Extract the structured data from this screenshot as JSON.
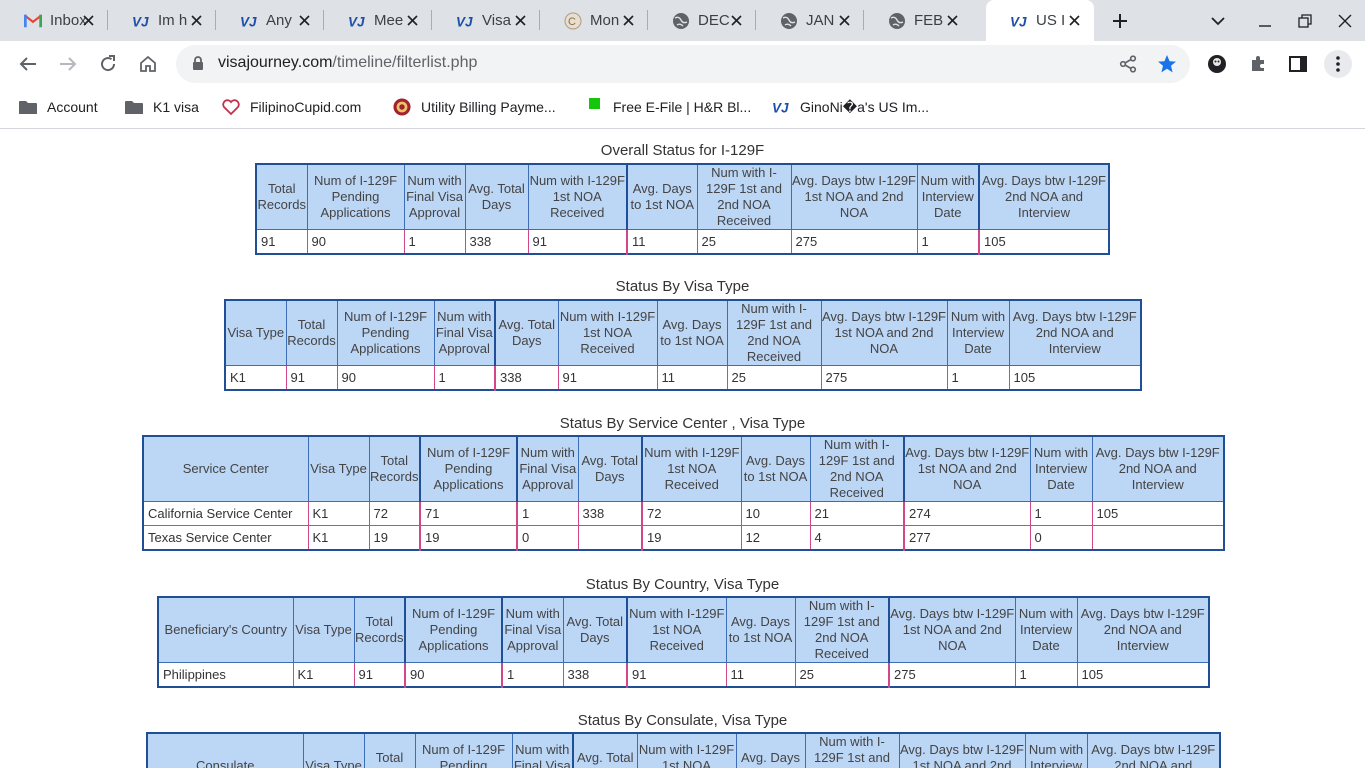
{
  "browser": {
    "tabs": [
      {
        "title": "Inbox",
        "favicon": "gmail-icon"
      },
      {
        "title": "Im h",
        "favicon": "vj-icon"
      },
      {
        "title": "Any",
        "favicon": "vj-icon"
      },
      {
        "title": "Mee",
        "favicon": "vj-icon"
      },
      {
        "title": "Visa",
        "favicon": "vj-icon"
      },
      {
        "title": "Mon",
        "favicon": "c-icon"
      },
      {
        "title": "DEC",
        "favicon": "globe-icon"
      },
      {
        "title": "JAN",
        "favicon": "globe-icon"
      },
      {
        "title": "FEB",
        "favicon": "globe-icon"
      },
      {
        "title": "US I",
        "favicon": "vj-icon",
        "active": true
      }
    ],
    "url_host": "visajourney.com",
    "url_path": "/timeline/filterlist.php",
    "bookmarks": [
      {
        "label": "Account",
        "icon": "folder-icon"
      },
      {
        "label": "K1 visa",
        "icon": "folder-icon"
      },
      {
        "label": "FilipinoCupid.com",
        "icon": "heart-icon"
      },
      {
        "label": "Utility Billing Payme...",
        "icon": "seal-icon"
      },
      {
        "label": "Free E-File | H&R Bl...",
        "icon": "green-square-icon"
      },
      {
        "label": "GinoNi�a's US Im...",
        "icon": "vj-icon"
      }
    ],
    "colors": {
      "accent_blue": "#1a73e8",
      "header_fill": "#bcd6f6",
      "cell_border": "#d0478a"
    }
  },
  "common_headers": {
    "total_records": "Total Records",
    "num_pending": "Num of I-129F Pending Applications",
    "num_final": "Num with Final Visa Approval",
    "avg_total": "Avg. Total Days",
    "num_1st_noa": "Num with I-129F 1st NOA Received",
    "avg_1st": "Avg. Days to 1st NOA",
    "num_both": "Num with I-129F 1st and 2nd NOA Received",
    "avg_btw": "Avg. Days btw I-129F 1st NOA and 2nd NOA",
    "num_interview": "Num with Interview Date",
    "avg_interview": "Avg. Days btw I-129F 2nd NOA and Interview",
    "visa_type": "Visa Type",
    "service_center": "Service Center",
    "country": "Beneficiary's Country",
    "consulate": "Consulate"
  },
  "sections": {
    "overall": {
      "title": "Overall Status for I-129F",
      "rows": [
        [
          "91",
          "90",
          "1",
          "338",
          "91",
          "11",
          "25",
          "275",
          "1",
          "105"
        ]
      ]
    },
    "visa_type": {
      "title": "Status By Visa Type",
      "rows": [
        [
          "K1",
          "91",
          "90",
          "1",
          "338",
          "91",
          "11",
          "25",
          "275",
          "1",
          "105"
        ]
      ]
    },
    "service_center": {
      "title": "Status By Service Center , Visa Type",
      "rows": [
        [
          "California Service Center",
          "K1",
          "72",
          "71",
          "1",
          "338",
          "72",
          "10",
          "21",
          "274",
          "1",
          "105"
        ],
        [
          "Texas Service Center",
          "K1",
          "19",
          "19",
          "0",
          "",
          "19",
          "12",
          "4",
          "277",
          "0",
          ""
        ]
      ]
    },
    "country": {
      "title": "Status By Country, Visa Type",
      "rows": [
        [
          "Philippines",
          "K1",
          "91",
          "90",
          "1",
          "338",
          "91",
          "11",
          "25",
          "275",
          "1",
          "105"
        ]
      ]
    },
    "consulate": {
      "title": "Status By Consulate, Visa Type"
    }
  }
}
